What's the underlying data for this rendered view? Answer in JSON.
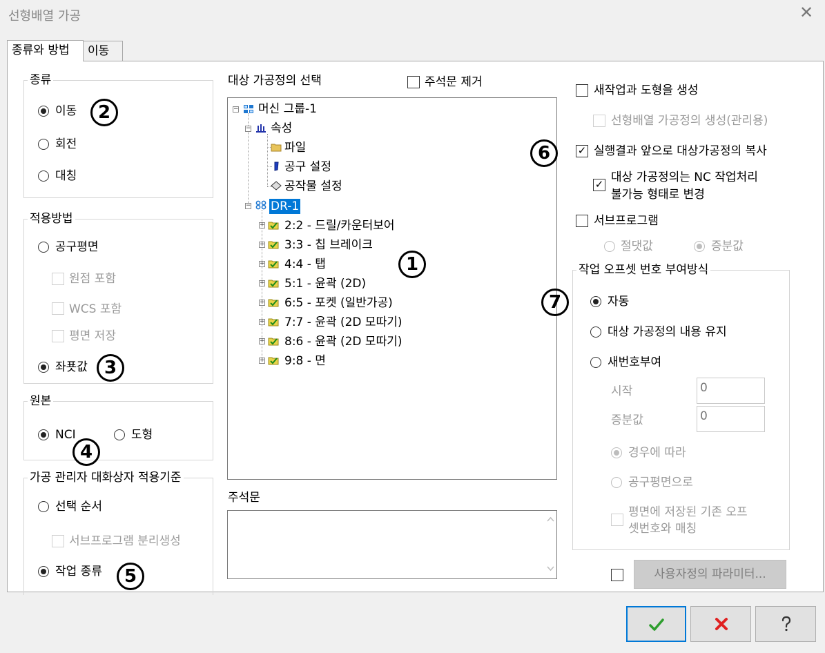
{
  "window": {
    "title": "선형배열 가공",
    "close_glyph": "✕"
  },
  "tabs": [
    {
      "label": "종류와 방법",
      "active": true
    },
    {
      "label": "이동",
      "active": false
    }
  ],
  "type_group": {
    "label": "종류",
    "options": [
      {
        "label": "이동",
        "checked": true
      },
      {
        "label": "회전",
        "checked": false
      },
      {
        "label": "대칭",
        "checked": false
      }
    ]
  },
  "method_group": {
    "label": "적용방법",
    "tool_plane": "공구평면",
    "origin_include": "원점 포함",
    "wcs_include": "WCS 포함",
    "plane_save": "평면 저장",
    "coordinates": "좌푯값"
  },
  "source_group": {
    "label": "원본",
    "nci": "NCI",
    "geometry": "도형"
  },
  "manager_group": {
    "label": "가공 관리자 대화상자 적용기준",
    "select_order": "선택 순서",
    "subprogram_separate": "서브프로그램 분리생성",
    "op_type": "작업 종류"
  },
  "target": {
    "label": "대상 가공정의 선택",
    "remove_comments": "주석문 제거",
    "tree": {
      "root": "머신 그룹-1",
      "properties": "속성",
      "prop_children": [
        "파일",
        "공구 설정",
        "공작물 설정"
      ],
      "toolpath_group": "DR-1",
      "operations": [
        "2:2 - 드릴/카운터보어",
        "3:3 - 칩 브레이크",
        "4:4 - 탭",
        "5:1 - 윤곽 (2D)",
        "6:5 - 포켓 (일반가공)",
        "7:7 - 윤곽 (2D 모따기)",
        "8:6 - 윤곽 (2D 모따기)",
        "9:8 - 면"
      ]
    }
  },
  "comment": {
    "label": "주석문",
    "value": ""
  },
  "right": {
    "new_op_geom": "새작업과 도형을 생성",
    "linear_def_manage": "선형배열 가공정의 생성(관리용)",
    "copy_before_after": "실행결과 앞으로 대상가공정의 복사",
    "disable_nc_line1": "대상 가공정의는 NC 작업처리",
    "disable_nc_line2": "불가능 형태로 변경",
    "subprogram": "서브프로그램",
    "absolute": "절댓값",
    "incremental": "증분값"
  },
  "offset_group": {
    "label": "작업 오프셋 번호 부여방식",
    "auto": "자동",
    "keep": "대상 가공정의 내용 유지",
    "renumber": "새번호부여",
    "start_label": "시작",
    "start_value": "0",
    "inc_label": "증분값",
    "inc_value": "0",
    "as_case": "경우에 따라",
    "by_tool_plane": "공구평면으로",
    "match_line1": "평면에 저장된 기존 오프",
    "match_line2": "셋번호와 매칭"
  },
  "custom_params_button": "사용자정의 파라미터...",
  "callouts": [
    "1",
    "2",
    "3",
    "4",
    "5",
    "6",
    "7"
  ],
  "buttons": {
    "ok_icon": "check-icon",
    "cancel_icon": "x-icon",
    "help_icon": "help-icon"
  },
  "colors": {
    "selection": "#0078d7",
    "ok_green": "#2e9e2e",
    "cancel_red": "#e02020"
  }
}
